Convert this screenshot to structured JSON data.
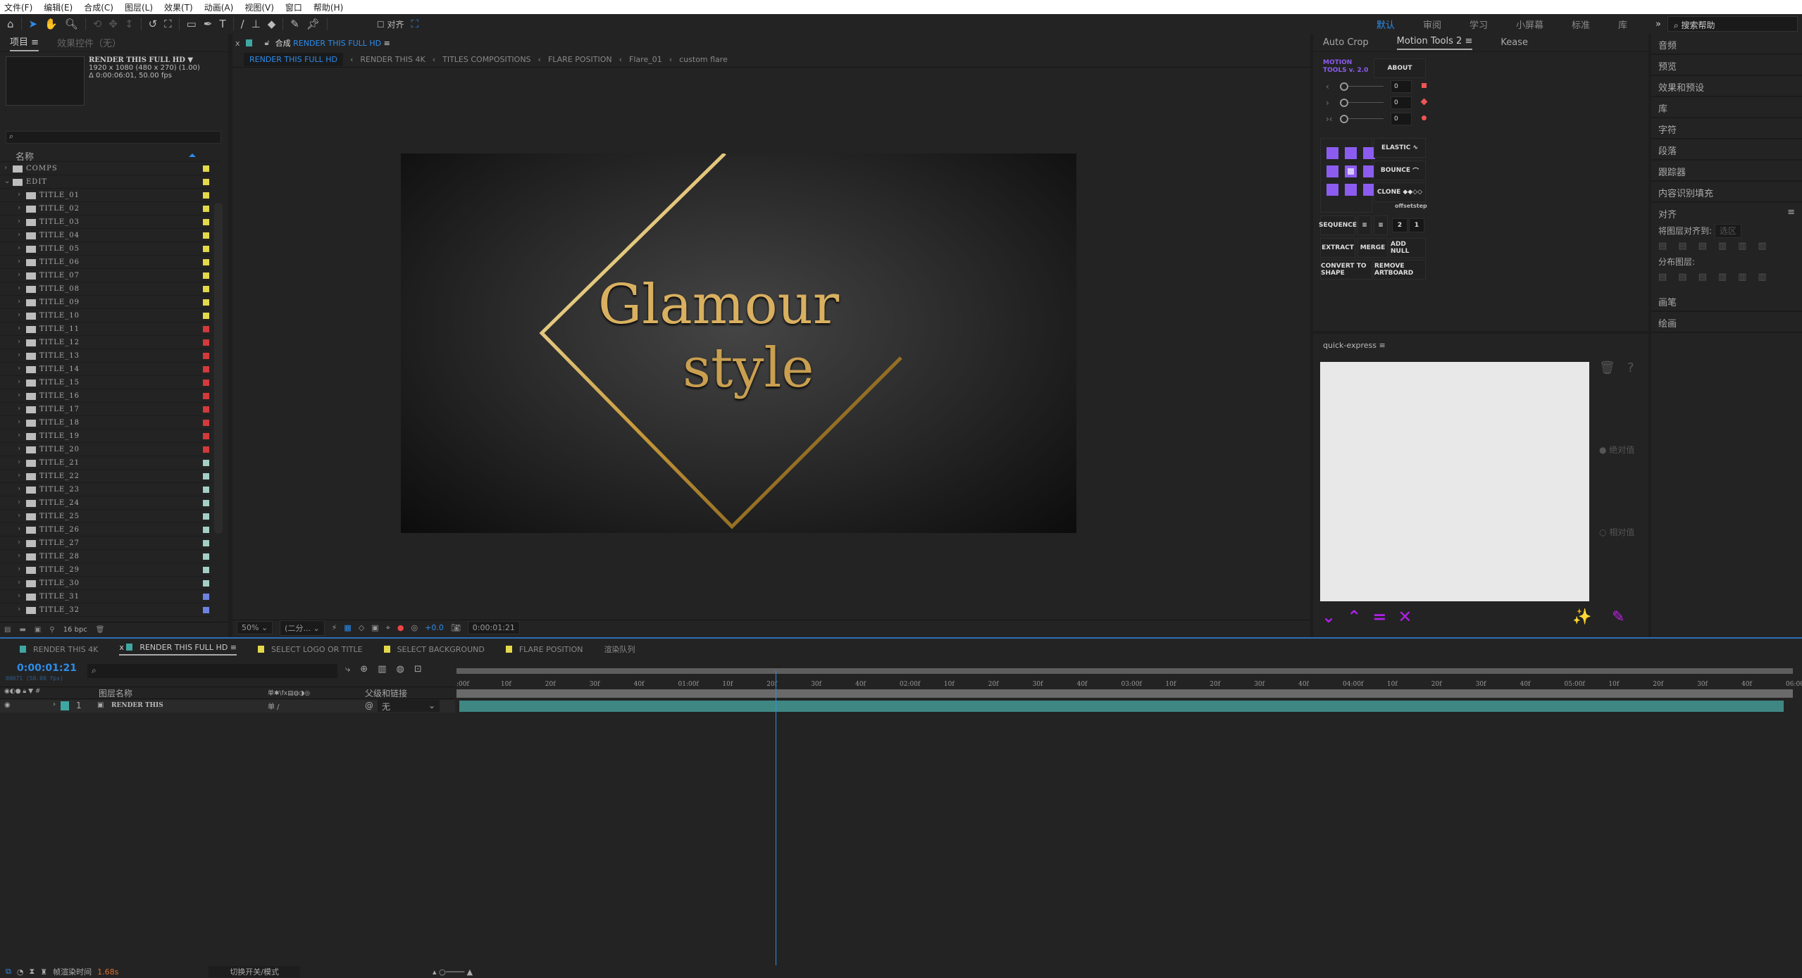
{
  "menu": [
    "文件(F)",
    "编辑(E)",
    "合成(C)",
    "图层(L)",
    "效果(T)",
    "动画(A)",
    "视图(V)",
    "窗口",
    "帮助(H)"
  ],
  "toolbar": {
    "align_label": "对齐",
    "workspaces": [
      "默认",
      "审阅",
      "学习",
      "小屏幕",
      "标准",
      "库"
    ],
    "active_workspace": "默认",
    "help_placeholder": "搜索帮助"
  },
  "project": {
    "tabs": [
      "项目",
      "效果控件（无）"
    ],
    "comp_name": "RENDER THIS FULL HD ▼",
    "comp_size": "1920 x 1080  (480 x 270) (1.00)",
    "comp_duration": "Δ 0:00:06:01, 50.00 fps",
    "column_name": "名称",
    "items": [
      {
        "name": "COMPS",
        "expanded": false,
        "level": 0,
        "color": "#e3d94a"
      },
      {
        "name": "EDIT",
        "expanded": true,
        "level": 0,
        "color": "#e3d94a"
      }
    ],
    "titles": [
      "TITLE_01",
      "TITLE_02",
      "TITLE_03",
      "TITLE_04",
      "TITLE_05",
      "TITLE_06",
      "TITLE_07",
      "TITLE_08",
      "TITLE_09",
      "TITLE_10",
      "TITLE_11",
      "TITLE_12",
      "TITLE_13",
      "TITLE_14",
      "TITLE_15",
      "TITLE_16",
      "TITLE_17",
      "TITLE_18",
      "TITLE_19",
      "TITLE_20",
      "TITLE_21",
      "TITLE_22",
      "TITLE_23",
      "TITLE_24",
      "TITLE_25",
      "TITLE_26",
      "TITLE_27",
      "TITLE_28",
      "TITLE_29",
      "TITLE_30",
      "TITLE_31",
      "TITLE_32"
    ],
    "label_colors": {
      "yellow": "#e3d94a",
      "red": "#d33a3a",
      "aqua": "#a4cfc7",
      "blue": "#6c83e0"
    },
    "bpc": "16 bpc"
  },
  "viewer": {
    "tab_prefix": "合成",
    "tab_title": "RENDER THIS FULL HD",
    "breadcrumbs": [
      "RENDER THIS FULL HD",
      "RENDER THIS  4K",
      "TITLES COMPOSITIONS",
      "FLARE POSITION",
      "Flare_01",
      "custom flare"
    ],
    "comp_text_1": "Glamour",
    "comp_text_2": "style",
    "zoom": "50%",
    "resolution": "(二分...",
    "exposure": "+0.0",
    "timecode": "0:00:01:21"
  },
  "motion_tools": {
    "tabs": [
      "Auto Crop",
      "Motion Tools 2",
      "Kease"
    ],
    "logo": "MOTION TOOLS v. 2.0",
    "about": "ABOUT",
    "sliders": [
      {
        "icon": "‹",
        "value": "0"
      },
      {
        "icon": "›",
        "value": "0"
      },
      {
        "icon": "›‹",
        "value": "0"
      }
    ],
    "elastic": "ELASTIC",
    "bounce": "BOUNCE",
    "clone": "CLONE",
    "offset_label": "offset",
    "step_label": "step",
    "sequence": "SEQUENCE",
    "offset": "2",
    "step": "1",
    "extract": "EXTRACT",
    "merge": "MERGE",
    "add_null": "ADD NULL",
    "convert": "CONVERT TO SHAPE",
    "remove_artboard": "REMOVE ARTBOARD",
    "accent": "#8c5cf0"
  },
  "quick_express": {
    "title": "quick-express",
    "absolute": "绝对值",
    "relative": "相对值",
    "accent": "#b020e8"
  },
  "right_panels": [
    "音频",
    "预览",
    "效果和预设",
    "库",
    "字符",
    "段落",
    "跟踪器",
    "内容识别填充"
  ],
  "align": {
    "title": "对齐",
    "align_to_label": "将图层对齐到:",
    "align_to_value": "选区",
    "distribute_label": "分布图层:"
  },
  "right_panels_bottom": [
    "画笔",
    "绘画"
  ],
  "timeline": {
    "tabs": [
      {
        "label": "RENDER THIS  4K",
        "color": "#3fa7a2"
      },
      {
        "label": "RENDER THIS FULL HD",
        "color": "#3fa7a2",
        "active": true
      },
      {
        "label": "SELECT LOGO OR TITLE",
        "color": "#e3d94a"
      },
      {
        "label": "SELECT BACKGROUND",
        "color": "#e3d94a"
      },
      {
        "label": "FLARE POSITION",
        "color": "#e3d94a"
      },
      {
        "label": "渲染队列"
      }
    ],
    "timecode": "0:00:01:21",
    "frame": "00071 (50.00 fps)",
    "col_layer_name": "图层名称",
    "col_parent": "父级和链接",
    "layers": [
      {
        "index": "1",
        "name": "RENDER THIS",
        "parent": "无",
        "color": "#3fa7a2"
      }
    ],
    "ruler_labels": [
      ":00f",
      "10f",
      "20f",
      "30f",
      "40f",
      "01:00f",
      "10f",
      "20f",
      "30f",
      "40f",
      "02:00f",
      "10f",
      "20f",
      "30f",
      "40f",
      "03:00f",
      "10f",
      "20f",
      "30f",
      "40f",
      "04:00f",
      "10f",
      "20f",
      "30f",
      "40f",
      "05:00f",
      "10f",
      "20f",
      "30f",
      "40f",
      "06:00"
    ],
    "playhead_frame": 71,
    "total_frames": 301
  },
  "status": {
    "render_time_label": "帧渲染时间",
    "render_time": "1.68s",
    "toggle_label": "切换开关/模式"
  }
}
